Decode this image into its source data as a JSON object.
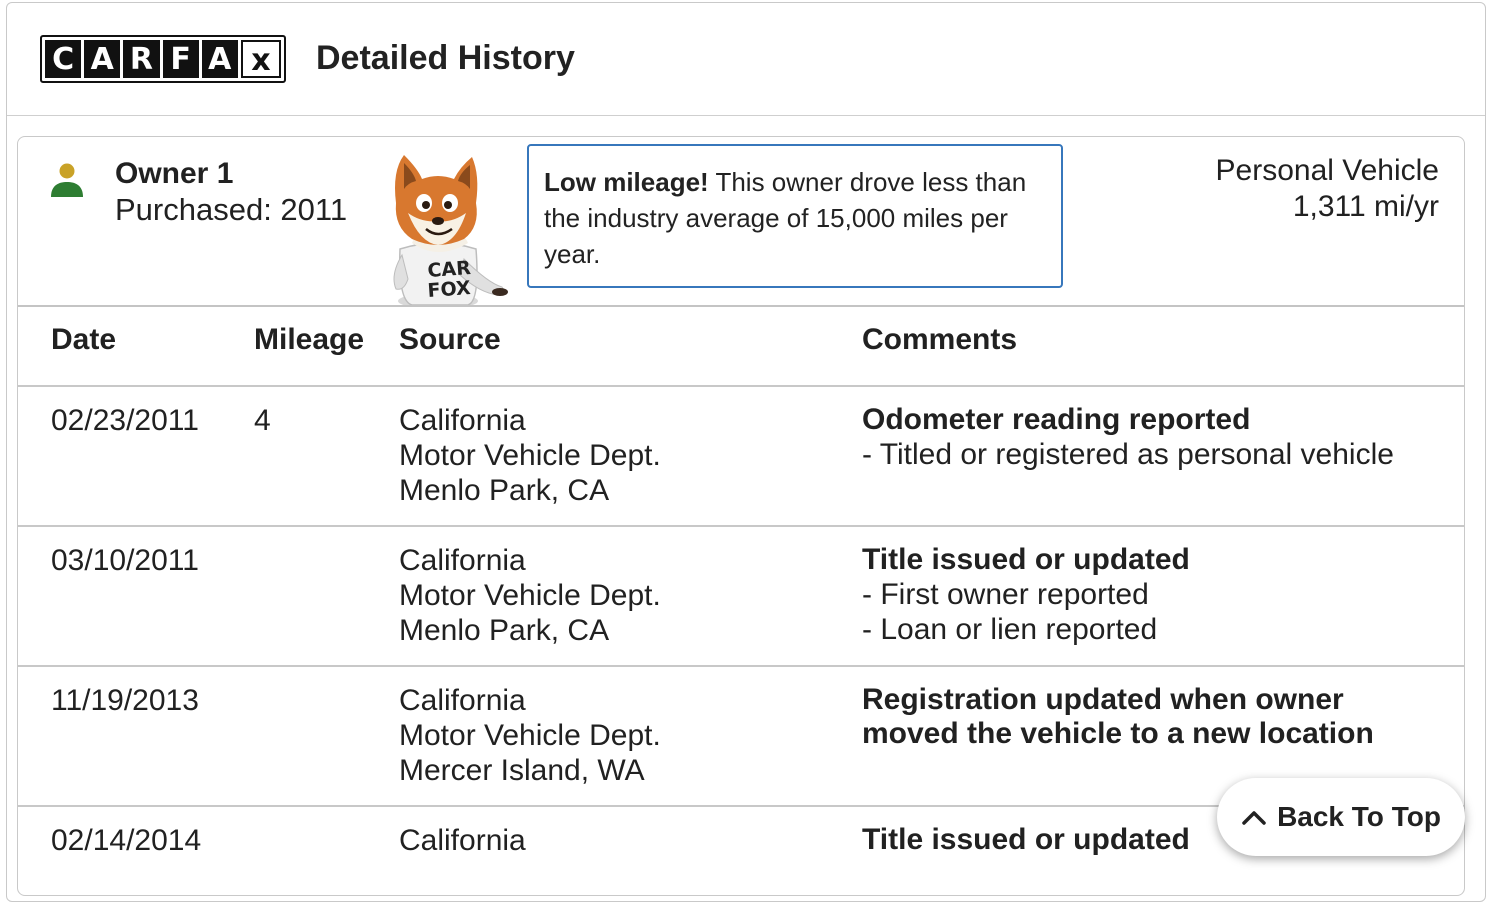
{
  "header": {
    "logo_letters": [
      "C",
      "A",
      "R",
      "F",
      "A",
      "x"
    ],
    "title": "Detailed History"
  },
  "owner": {
    "name": "Owner 1",
    "purchased": "Purchased: 2011",
    "mascot_shirt": "CAR FOX",
    "tip_bold": "Low mileage!",
    "tip_text": " This owner drove less than the industry average of 15,000 miles per year.",
    "vehicle_type": "Personal Vehicle",
    "mileage_rate": "1,311 mi/yr",
    "person_icon_color": "#2e7d32",
    "person_head_color": "#c9a227"
  },
  "table": {
    "headers": {
      "date": "Date",
      "mileage": "Mileage",
      "source": "Source",
      "comments": "Comments"
    },
    "rows": [
      {
        "date": "02/23/2011",
        "mileage": "4",
        "source": [
          "California",
          "Motor Vehicle Dept.",
          "Menlo Park, CA"
        ],
        "comment_title": "Odometer reading reported",
        "comment_lines": [
          "- Titled or registered as personal vehicle"
        ]
      },
      {
        "date": "03/10/2011",
        "mileage": "",
        "source": [
          "California",
          "Motor Vehicle Dept.",
          "Menlo Park, CA"
        ],
        "comment_title": "Title issued or updated",
        "comment_lines": [
          "- First owner reported",
          "- Loan or lien reported"
        ]
      },
      {
        "date": "11/19/2013",
        "mileage": "",
        "source": [
          "California",
          "Motor Vehicle Dept.",
          "Mercer Island, WA"
        ],
        "comment_title": "Registration updated when owner moved the vehicle to a new location",
        "comment_lines": []
      },
      {
        "date": "02/14/2014",
        "mileage": "",
        "source": [
          "California"
        ],
        "comment_title": "Title issued or updated",
        "comment_lines": []
      }
    ]
  },
  "back_to_top": {
    "label": "Back To Top",
    "icon": "chevron-up-icon"
  }
}
